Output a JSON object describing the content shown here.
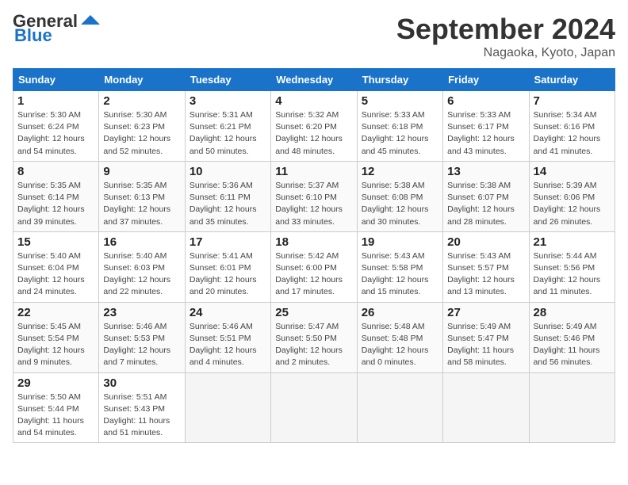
{
  "header": {
    "logo_line1": "General",
    "logo_line2": "Blue",
    "month": "September 2024",
    "location": "Nagaoka, Kyoto, Japan"
  },
  "days_of_week": [
    "Sunday",
    "Monday",
    "Tuesday",
    "Wednesday",
    "Thursday",
    "Friday",
    "Saturday"
  ],
  "weeks": [
    [
      {
        "day": 1,
        "info": "Sunrise: 5:30 AM\nSunset: 6:24 PM\nDaylight: 12 hours\nand 54 minutes."
      },
      {
        "day": 2,
        "info": "Sunrise: 5:30 AM\nSunset: 6:23 PM\nDaylight: 12 hours\nand 52 minutes."
      },
      {
        "day": 3,
        "info": "Sunrise: 5:31 AM\nSunset: 6:21 PM\nDaylight: 12 hours\nand 50 minutes."
      },
      {
        "day": 4,
        "info": "Sunrise: 5:32 AM\nSunset: 6:20 PM\nDaylight: 12 hours\nand 48 minutes."
      },
      {
        "day": 5,
        "info": "Sunrise: 5:33 AM\nSunset: 6:18 PM\nDaylight: 12 hours\nand 45 minutes."
      },
      {
        "day": 6,
        "info": "Sunrise: 5:33 AM\nSunset: 6:17 PM\nDaylight: 12 hours\nand 43 minutes."
      },
      {
        "day": 7,
        "info": "Sunrise: 5:34 AM\nSunset: 6:16 PM\nDaylight: 12 hours\nand 41 minutes."
      }
    ],
    [
      {
        "day": 8,
        "info": "Sunrise: 5:35 AM\nSunset: 6:14 PM\nDaylight: 12 hours\nand 39 minutes."
      },
      {
        "day": 9,
        "info": "Sunrise: 5:35 AM\nSunset: 6:13 PM\nDaylight: 12 hours\nand 37 minutes."
      },
      {
        "day": 10,
        "info": "Sunrise: 5:36 AM\nSunset: 6:11 PM\nDaylight: 12 hours\nand 35 minutes."
      },
      {
        "day": 11,
        "info": "Sunrise: 5:37 AM\nSunset: 6:10 PM\nDaylight: 12 hours\nand 33 minutes."
      },
      {
        "day": 12,
        "info": "Sunrise: 5:38 AM\nSunset: 6:08 PM\nDaylight: 12 hours\nand 30 minutes."
      },
      {
        "day": 13,
        "info": "Sunrise: 5:38 AM\nSunset: 6:07 PM\nDaylight: 12 hours\nand 28 minutes."
      },
      {
        "day": 14,
        "info": "Sunrise: 5:39 AM\nSunset: 6:06 PM\nDaylight: 12 hours\nand 26 minutes."
      }
    ],
    [
      {
        "day": 15,
        "info": "Sunrise: 5:40 AM\nSunset: 6:04 PM\nDaylight: 12 hours\nand 24 minutes."
      },
      {
        "day": 16,
        "info": "Sunrise: 5:40 AM\nSunset: 6:03 PM\nDaylight: 12 hours\nand 22 minutes."
      },
      {
        "day": 17,
        "info": "Sunrise: 5:41 AM\nSunset: 6:01 PM\nDaylight: 12 hours\nand 20 minutes."
      },
      {
        "day": 18,
        "info": "Sunrise: 5:42 AM\nSunset: 6:00 PM\nDaylight: 12 hours\nand 17 minutes."
      },
      {
        "day": 19,
        "info": "Sunrise: 5:43 AM\nSunset: 5:58 PM\nDaylight: 12 hours\nand 15 minutes."
      },
      {
        "day": 20,
        "info": "Sunrise: 5:43 AM\nSunset: 5:57 PM\nDaylight: 12 hours\nand 13 minutes."
      },
      {
        "day": 21,
        "info": "Sunrise: 5:44 AM\nSunset: 5:56 PM\nDaylight: 12 hours\nand 11 minutes."
      }
    ],
    [
      {
        "day": 22,
        "info": "Sunrise: 5:45 AM\nSunset: 5:54 PM\nDaylight: 12 hours\nand 9 minutes."
      },
      {
        "day": 23,
        "info": "Sunrise: 5:46 AM\nSunset: 5:53 PM\nDaylight: 12 hours\nand 7 minutes."
      },
      {
        "day": 24,
        "info": "Sunrise: 5:46 AM\nSunset: 5:51 PM\nDaylight: 12 hours\nand 4 minutes."
      },
      {
        "day": 25,
        "info": "Sunrise: 5:47 AM\nSunset: 5:50 PM\nDaylight: 12 hours\nand 2 minutes."
      },
      {
        "day": 26,
        "info": "Sunrise: 5:48 AM\nSunset: 5:48 PM\nDaylight: 12 hours\nand 0 minutes."
      },
      {
        "day": 27,
        "info": "Sunrise: 5:49 AM\nSunset: 5:47 PM\nDaylight: 11 hours\nand 58 minutes."
      },
      {
        "day": 28,
        "info": "Sunrise: 5:49 AM\nSunset: 5:46 PM\nDaylight: 11 hours\nand 56 minutes."
      }
    ],
    [
      {
        "day": 29,
        "info": "Sunrise: 5:50 AM\nSunset: 5:44 PM\nDaylight: 11 hours\nand 54 minutes."
      },
      {
        "day": 30,
        "info": "Sunrise: 5:51 AM\nSunset: 5:43 PM\nDaylight: 11 hours\nand 51 minutes."
      },
      null,
      null,
      null,
      null,
      null
    ]
  ]
}
